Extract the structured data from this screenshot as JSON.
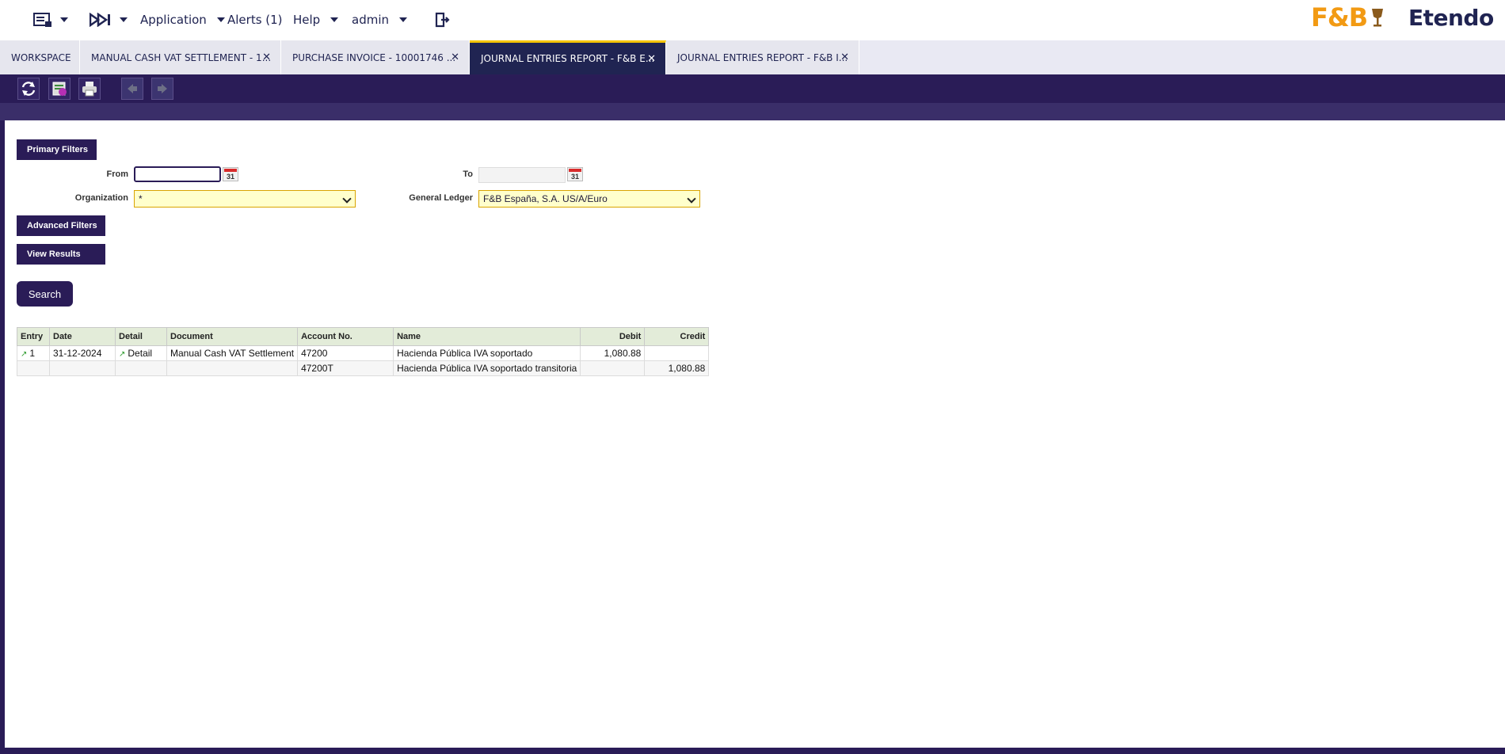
{
  "topbar": {
    "application_label": "Application",
    "alerts_label": "Alerts (1)",
    "help_label": "Help",
    "user_label": "admin",
    "logo_fb": "F&B",
    "logo_etendo": "Etendo"
  },
  "tabs": [
    {
      "label": "WORKSPACE",
      "closable": false,
      "active": false
    },
    {
      "label": "MANUAL CASH VAT SETTLEMENT - 1...",
      "closable": true,
      "active": false
    },
    {
      "label": "PURCHASE INVOICE - 10001746 ...",
      "closable": true,
      "active": false
    },
    {
      "label": "JOURNAL ENTRIES REPORT - F&B E...",
      "closable": true,
      "active": true
    },
    {
      "label": "JOURNAL ENTRIES REPORT - F&B I...",
      "closable": true,
      "active": false
    }
  ],
  "filters": {
    "primary_label": "Primary Filters",
    "from_label": "From",
    "from_value": "",
    "to_label": "To",
    "to_value": "",
    "calendar_glyph": "31",
    "organization_label": "Organization",
    "organization_value": "*",
    "ledger_label": "General Ledger",
    "ledger_value": "F&B España, S.A. US/A/Euro",
    "advanced_label": "Advanced Filters",
    "results_label": "View Results",
    "search_label": "Search"
  },
  "table": {
    "headers": [
      "Entry",
      "Date",
      "Detail",
      "Document",
      "Account No.",
      "Name",
      "Debit",
      "Credit"
    ],
    "rows": [
      {
        "entry": "1",
        "date": "31-12-2024",
        "detail": "Detail",
        "document": "Manual Cash VAT Settlement",
        "account": "47200",
        "name": "Hacienda Pública IVA soportado",
        "debit": "1,080.88",
        "credit": ""
      },
      {
        "entry": "",
        "date": "",
        "detail": "",
        "document": "",
        "account": "47200T",
        "name": "Hacienda Pública IVA soportado transitoria",
        "debit": "",
        "credit": "1,080.88"
      }
    ]
  },
  "colors": {
    "brand_dark": "#2a1c57",
    "accent_yellow": "#f5c400",
    "logo_orange": "#f29a13"
  }
}
